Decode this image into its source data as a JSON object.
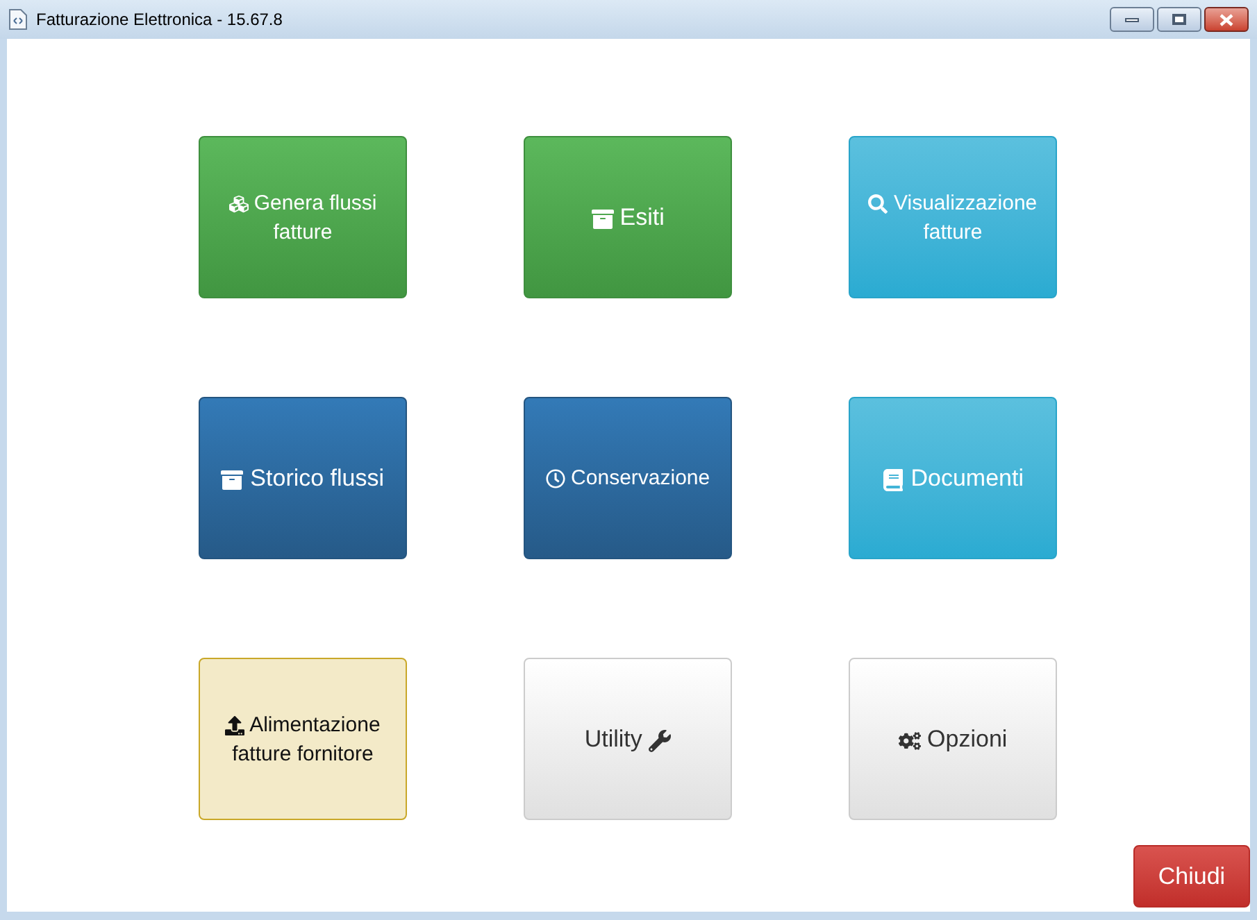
{
  "window": {
    "title": "Fatturazione Elettronica - 15.67.8"
  },
  "tiles": [
    {
      "label": "Genera flussi fatture",
      "kind": "success",
      "large": false,
      "icon_after": false
    },
    {
      "label": "Esiti",
      "kind": "success",
      "large": true,
      "icon_after": false
    },
    {
      "label": "Visualizzazione fatture",
      "kind": "info",
      "large": false,
      "icon_after": false
    },
    {
      "label": "Storico flussi",
      "kind": "primary",
      "large": true,
      "icon_after": false
    },
    {
      "label": "Conservazione",
      "kind": "primary",
      "large": false,
      "icon_after": false
    },
    {
      "label": "Documenti",
      "kind": "info",
      "large": true,
      "icon_after": false
    },
    {
      "label": "Alimentazione fatture fornitore",
      "kind": "warning",
      "large": false,
      "icon_after": false
    },
    {
      "label": "Utility",
      "kind": "default",
      "large": true,
      "icon_after": true
    },
    {
      "label": "Opzioni",
      "kind": "default",
      "large": true,
      "icon_after": false
    }
  ],
  "close_button": {
    "label": "Chiudi"
  }
}
